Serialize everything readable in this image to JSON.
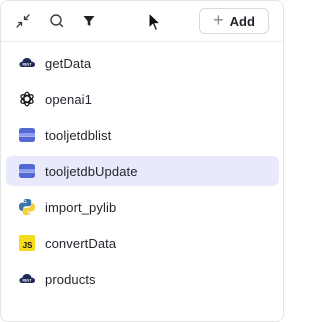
{
  "toolbar": {
    "tools": [
      {
        "icon": "collapse-icon"
      },
      {
        "icon": "search-icon"
      },
      {
        "icon": "filter-icon"
      }
    ],
    "add_label": "Add"
  },
  "queries": [
    {
      "name": "getData",
      "icon": "restapi-icon",
      "selected": false
    },
    {
      "name": "openai1",
      "icon": "openai-icon",
      "selected": false
    },
    {
      "name": "tooljetdblist",
      "icon": "tooljetdb-icon",
      "selected": false
    },
    {
      "name": "tooljetdbUpdate",
      "icon": "tooljetdb-icon",
      "selected": true
    },
    {
      "name": "import_pylib",
      "icon": "python-icon",
      "selected": false
    },
    {
      "name": "convertData",
      "icon": "javascript-icon",
      "selected": false
    },
    {
      "name": "products",
      "icon": "restapi-icon",
      "selected": false
    }
  ],
  "icon_labels": {
    "restapi": "REST",
    "javascript": "JS"
  },
  "colors": {
    "selected_bg": "#e8eafc",
    "tooljetdb": "#5468d4",
    "restapi": "#1c2b57",
    "python_blue": "#3a73a8",
    "python_yellow": "#f5cf3c",
    "javascript": "#f5dc1e"
  }
}
